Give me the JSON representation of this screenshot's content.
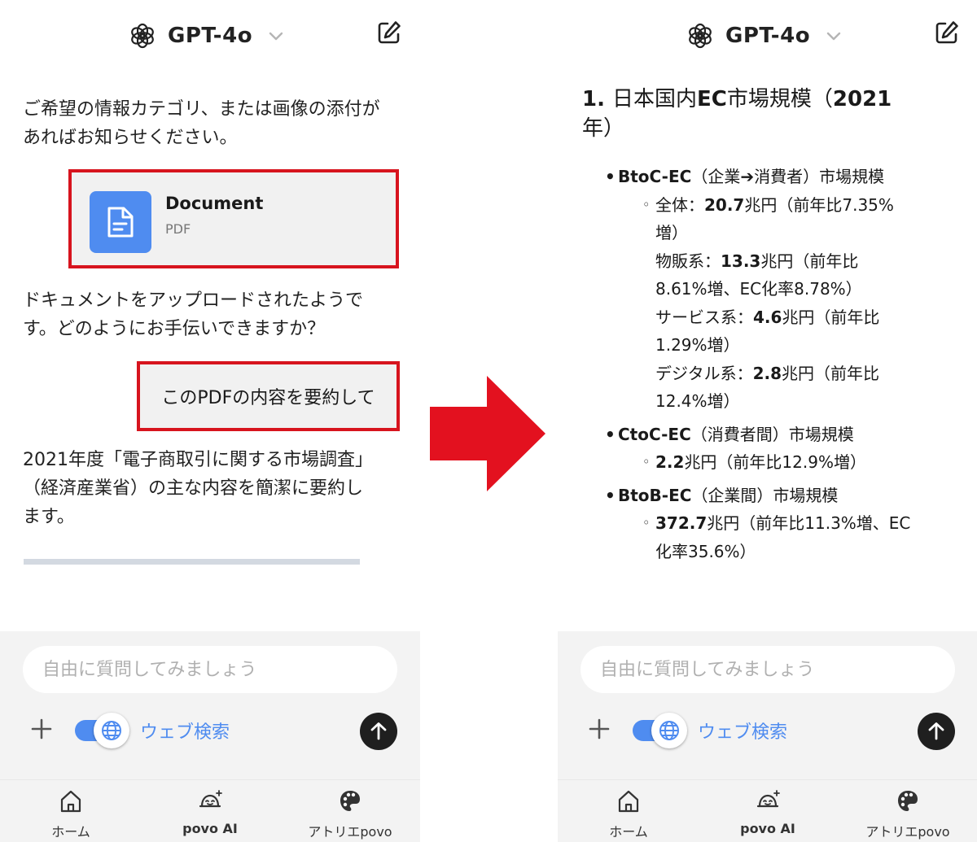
{
  "colors": {
    "highlight_border": "#d7141e",
    "accent_blue": "#4f8cf0",
    "arrow_red": "#e3111f",
    "composer_bg": "#f3f3f3",
    "send_button": "#1f1f1f"
  },
  "left": {
    "header": {
      "model_name": "GPT-4o",
      "logo_icon": "openai-logo-icon",
      "chevron_icon": "chevron-down-icon",
      "new_chat_icon": "edit-icon"
    },
    "messages": {
      "assistant_1": "ご希望の情報カテゴリ、または画像の添付があればお知らせください。",
      "attachment": {
        "title": "Document",
        "type": "PDF",
        "icon": "document-icon"
      },
      "assistant_2": "ドキュメントをアップロードされたようです。どのようにお手伝いできますか？",
      "user_1": "このPDFの内容を要約して",
      "assistant_3": "2021年度「電子商取引に関する市場調査」（経済産業省）の主な内容を簡潔に要約します。"
    },
    "composer": {
      "placeholder": "自由に質問してみましょう",
      "web_search_label": "ウェブ検索",
      "web_search_on": true
    },
    "nav": [
      {
        "label": "ホーム",
        "icon": "home-icon"
      },
      {
        "label": "povo AI",
        "icon": "povo-ai-icon"
      },
      {
        "label": "アトリエpovo",
        "icon": "palette-icon"
      }
    ]
  },
  "right": {
    "header": {
      "model_name": "GPT-4o",
      "logo_icon": "openai-logo-icon",
      "chevron_icon": "chevron-down-icon",
      "new_chat_icon": "edit-icon"
    },
    "summary": {
      "title_num": "1. ",
      "title_a": "日本国内",
      "title_b": "EC",
      "title_c": "市場規模（",
      "title_d": "2021",
      "title_e": "年）",
      "btoc": {
        "head_bold": "BtoC-EC",
        "head_rest": "（企業➔消費者）市場規模",
        "total_a": "全体：",
        "total_b": "20.7",
        "total_c": "兆円（前年比7.35%",
        "total_d": "増）",
        "goods_a": "物販系：",
        "goods_b": "13.3",
        "goods_c": "兆円（前年比",
        "goods_d": "8.61%増、EC化率8.78%）",
        "service_a": "サービス系：",
        "service_b": "4.6",
        "service_c": "兆円（前年比",
        "service_d": "1.29%増）",
        "digital_a": "デジタル系：",
        "digital_b": "2.8",
        "digital_c": "兆円（前年比",
        "digital_d": "12.4%増）"
      },
      "ctoc": {
        "head_bold": "CtoC-EC",
        "head_rest": "（消費者間）市場規模",
        "value_b": "2.2",
        "value_c": "兆円（前年比12.9%増）"
      },
      "btob": {
        "head_bold": "BtoB-EC",
        "head_rest": "（企業間）市場規模",
        "value_b": "372.7",
        "value_c": "兆円（前年比11.3%増、EC",
        "value_d": "化率35.6%）"
      }
    },
    "composer": {
      "placeholder": "自由に質問してみましょう",
      "web_search_label": "ウェブ検索",
      "web_search_on": true
    },
    "nav": [
      {
        "label": "ホーム",
        "icon": "home-icon"
      },
      {
        "label": "povo AI",
        "icon": "povo-ai-icon"
      },
      {
        "label": "アトリエpovo",
        "icon": "palette-icon"
      }
    ]
  },
  "arrow_icon": "arrow-right-icon"
}
